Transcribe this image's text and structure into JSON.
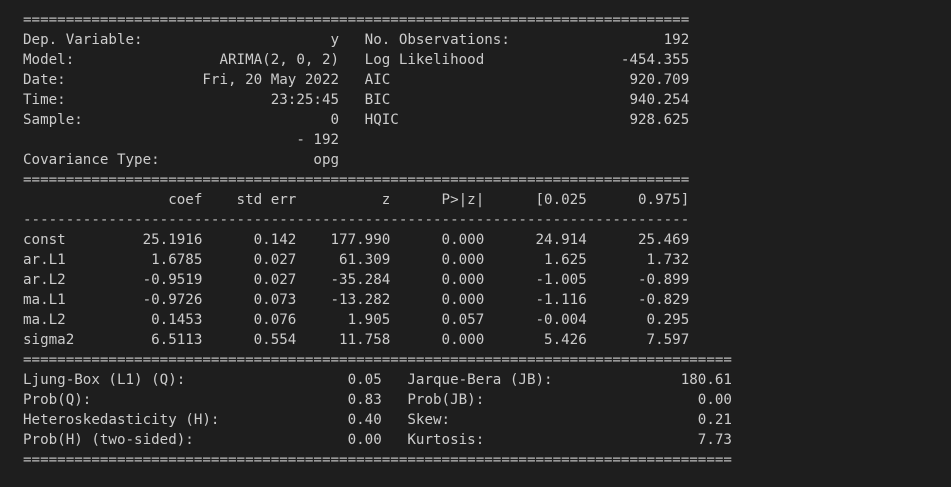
{
  "summary": {
    "lines": [
      "==============================================================================",
      "Dep. Variable:                      y   No. Observations:                  192",
      "Model:                 ARIMA(2, 0, 2)   Log Likelihood                -454.355",
      "Date:                Fri, 20 May 2022   AIC                            920.709",
      "Time:                        23:25:45   BIC                            940.254",
      "Sample:                             0   HQIC                           928.625",
      "                                - 192                                         ",
      "Covariance Type:                  opg                                         ",
      "==============================================================================",
      "                 coef    std err          z      P>|z|      [0.025      0.975]",
      "------------------------------------------------------------------------------",
      "const         25.1916      0.142    177.990      0.000      24.914      25.469",
      "ar.L1          1.6785      0.027     61.309      0.000       1.625       1.732",
      "ar.L2         -0.9519      0.027    -35.284      0.000      -1.005      -0.899",
      "ma.L1         -0.9726      0.073    -13.282      0.000      -1.116      -0.829",
      "ma.L2          0.1453      0.076      1.905      0.057      -0.004       0.295",
      "sigma2         6.5113      0.554     11.758      0.000       5.426       7.597",
      "===================================================================================",
      "Ljung-Box (L1) (Q):                   0.05   Jarque-Bera (JB):               180.61",
      "Prob(Q):                              0.83   Prob(JB):                         0.00",
      "Heteroskedasticity (H):               0.40   Skew:                             0.21",
      "Prob(H) (two-sided):                  0.00   Kurtosis:                         7.73",
      "==================================================================================="
    ]
  }
}
